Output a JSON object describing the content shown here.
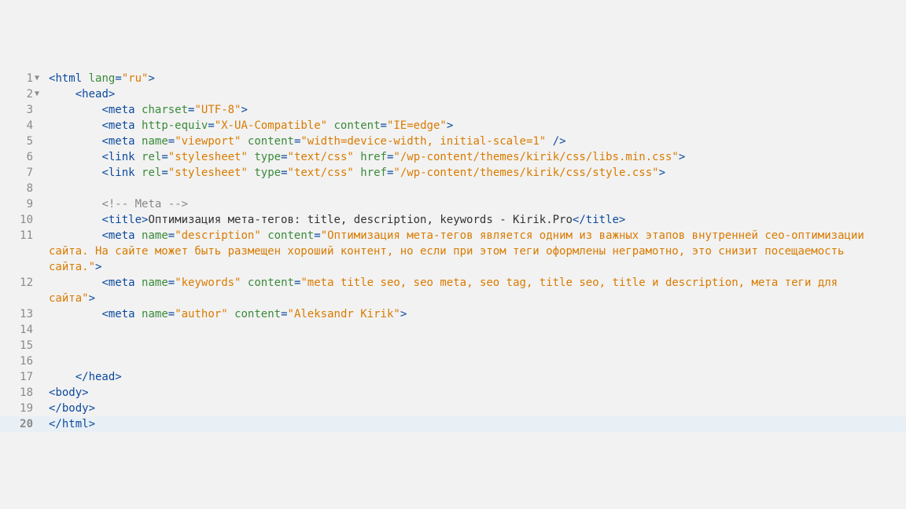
{
  "lines": [
    {
      "num": "1",
      "fold": "▼",
      "indent": 0,
      "tokens": [
        {
          "t": "punct",
          "v": "<"
        },
        {
          "t": "tag",
          "v": "html"
        },
        {
          "t": "text-content",
          "v": " "
        },
        {
          "t": "attr-name",
          "v": "lang"
        },
        {
          "t": "punct",
          "v": "="
        },
        {
          "t": "attr-val",
          "v": "\"ru\""
        },
        {
          "t": "punct",
          "v": ">"
        }
      ]
    },
    {
      "num": "2",
      "fold": "▼",
      "indent": 1,
      "tokens": [
        {
          "t": "punct",
          "v": "<"
        },
        {
          "t": "tag",
          "v": "head"
        },
        {
          "t": "punct",
          "v": ">"
        }
      ]
    },
    {
      "num": "3",
      "fold": "",
      "indent": 2,
      "tokens": [
        {
          "t": "punct",
          "v": "<"
        },
        {
          "t": "tag",
          "v": "meta"
        },
        {
          "t": "text-content",
          "v": " "
        },
        {
          "t": "attr-name",
          "v": "charset"
        },
        {
          "t": "punct",
          "v": "="
        },
        {
          "t": "attr-val",
          "v": "\"UTF-8\""
        },
        {
          "t": "punct",
          "v": ">"
        }
      ]
    },
    {
      "num": "4",
      "fold": "",
      "indent": 2,
      "tokens": [
        {
          "t": "punct",
          "v": "<"
        },
        {
          "t": "tag",
          "v": "meta"
        },
        {
          "t": "text-content",
          "v": " "
        },
        {
          "t": "attr-name",
          "v": "http-equiv"
        },
        {
          "t": "punct",
          "v": "="
        },
        {
          "t": "attr-val",
          "v": "\"X-UA-Compatible\""
        },
        {
          "t": "text-content",
          "v": " "
        },
        {
          "t": "attr-name",
          "v": "content"
        },
        {
          "t": "punct",
          "v": "="
        },
        {
          "t": "attr-val",
          "v": "\"IE=edge\""
        },
        {
          "t": "punct",
          "v": ">"
        }
      ]
    },
    {
      "num": "5",
      "fold": "",
      "indent": 2,
      "tokens": [
        {
          "t": "punct",
          "v": "<"
        },
        {
          "t": "tag",
          "v": "meta"
        },
        {
          "t": "text-content",
          "v": " "
        },
        {
          "t": "attr-name",
          "v": "name"
        },
        {
          "t": "punct",
          "v": "="
        },
        {
          "t": "attr-val",
          "v": "\"viewport\""
        },
        {
          "t": "text-content",
          "v": " "
        },
        {
          "t": "attr-name",
          "v": "content"
        },
        {
          "t": "punct",
          "v": "="
        },
        {
          "t": "attr-val",
          "v": "\"width=device-width, initial-scale=1\""
        },
        {
          "t": "text-content",
          "v": " "
        },
        {
          "t": "punct",
          "v": "/>"
        }
      ]
    },
    {
      "num": "6",
      "fold": "",
      "indent": 2,
      "tokens": [
        {
          "t": "punct",
          "v": "<"
        },
        {
          "t": "tag",
          "v": "link"
        },
        {
          "t": "text-content",
          "v": " "
        },
        {
          "t": "attr-name",
          "v": "rel"
        },
        {
          "t": "punct",
          "v": "="
        },
        {
          "t": "attr-val",
          "v": "\"stylesheet\""
        },
        {
          "t": "text-content",
          "v": " "
        },
        {
          "t": "attr-name",
          "v": "type"
        },
        {
          "t": "punct",
          "v": "="
        },
        {
          "t": "attr-val",
          "v": "\"text/css\""
        },
        {
          "t": "text-content",
          "v": " "
        },
        {
          "t": "attr-name",
          "v": "href"
        },
        {
          "t": "punct",
          "v": "="
        },
        {
          "t": "attr-val",
          "v": "\"/wp-content/themes/kirik/css/libs.min.css\""
        },
        {
          "t": "punct",
          "v": ">"
        }
      ]
    },
    {
      "num": "7",
      "fold": "",
      "indent": 2,
      "tokens": [
        {
          "t": "punct",
          "v": "<"
        },
        {
          "t": "tag",
          "v": "link"
        },
        {
          "t": "text-content",
          "v": " "
        },
        {
          "t": "attr-name",
          "v": "rel"
        },
        {
          "t": "punct",
          "v": "="
        },
        {
          "t": "attr-val",
          "v": "\"stylesheet\""
        },
        {
          "t": "text-content",
          "v": " "
        },
        {
          "t": "attr-name",
          "v": "type"
        },
        {
          "t": "punct",
          "v": "="
        },
        {
          "t": "attr-val",
          "v": "\"text/css\""
        },
        {
          "t": "text-content",
          "v": " "
        },
        {
          "t": "attr-name",
          "v": "href"
        },
        {
          "t": "punct",
          "v": "="
        },
        {
          "t": "attr-val",
          "v": "\"/wp-content/themes/kirik/css/style.css\""
        },
        {
          "t": "punct",
          "v": ">"
        }
      ]
    },
    {
      "num": "8",
      "fold": "",
      "indent": 0,
      "tokens": []
    },
    {
      "num": "9",
      "fold": "",
      "indent": 2,
      "tokens": [
        {
          "t": "comment",
          "v": "<!-- Meta -->"
        }
      ]
    },
    {
      "num": "10",
      "fold": "",
      "indent": 2,
      "tokens": [
        {
          "t": "punct",
          "v": "<"
        },
        {
          "t": "tag",
          "v": "title"
        },
        {
          "t": "punct",
          "v": ">"
        },
        {
          "t": "text-content",
          "v": "Оптимизация мета-тегов: title, description, keywords - Kirik.Pro"
        },
        {
          "t": "punct",
          "v": "</"
        },
        {
          "t": "tag",
          "v": "title"
        },
        {
          "t": "punct",
          "v": ">"
        }
      ]
    },
    {
      "num": "11",
      "fold": "",
      "indent": 2,
      "tokens": [
        {
          "t": "punct",
          "v": "<"
        },
        {
          "t": "tag",
          "v": "meta"
        },
        {
          "t": "text-content",
          "v": " "
        },
        {
          "t": "attr-name",
          "v": "name"
        },
        {
          "t": "punct",
          "v": "="
        },
        {
          "t": "attr-val",
          "v": "\"description\""
        },
        {
          "t": "text-content",
          "v": " "
        },
        {
          "t": "attr-name",
          "v": "content"
        },
        {
          "t": "punct",
          "v": "="
        },
        {
          "t": "attr-val",
          "v": "\"Оптимизация мета-тегов является одним из важных этапов внутренней сео-оптимизации сайта. На сайте может быть размещен хороший контент, но если при этом теги оформлены неграмотно, это снизит посещаемость сайта.\""
        },
        {
          "t": "punct",
          "v": ">"
        }
      ]
    },
    {
      "num": "12",
      "fold": "",
      "indent": 2,
      "tokens": [
        {
          "t": "punct",
          "v": "<"
        },
        {
          "t": "tag",
          "v": "meta"
        },
        {
          "t": "text-content",
          "v": " "
        },
        {
          "t": "attr-name",
          "v": "name"
        },
        {
          "t": "punct",
          "v": "="
        },
        {
          "t": "attr-val",
          "v": "\"keywords\""
        },
        {
          "t": "text-content",
          "v": " "
        },
        {
          "t": "attr-name",
          "v": "content"
        },
        {
          "t": "punct",
          "v": "="
        },
        {
          "t": "attr-val",
          "v": "\"meta title seo, seo meta, seo tag, title seo, title и description, мета теги для сайта\""
        },
        {
          "t": "punct",
          "v": ">"
        }
      ]
    },
    {
      "num": "13",
      "fold": "",
      "indent": 2,
      "tokens": [
        {
          "t": "punct",
          "v": "<"
        },
        {
          "t": "tag",
          "v": "meta"
        },
        {
          "t": "text-content",
          "v": " "
        },
        {
          "t": "attr-name",
          "v": "name"
        },
        {
          "t": "punct",
          "v": "="
        },
        {
          "t": "attr-val",
          "v": "\"author\""
        },
        {
          "t": "text-content",
          "v": " "
        },
        {
          "t": "attr-name",
          "v": "content"
        },
        {
          "t": "punct",
          "v": "="
        },
        {
          "t": "attr-val",
          "v": "\"Aleksandr Kirik\""
        },
        {
          "t": "punct",
          "v": ">"
        }
      ]
    },
    {
      "num": "14",
      "fold": "",
      "indent": 0,
      "tokens": []
    },
    {
      "num": "15",
      "fold": "",
      "indent": 0,
      "tokens": []
    },
    {
      "num": "16",
      "fold": "",
      "indent": 0,
      "tokens": []
    },
    {
      "num": "17",
      "fold": "",
      "indent": 1,
      "tokens": [
        {
          "t": "punct",
          "v": "</"
        },
        {
          "t": "tag",
          "v": "head"
        },
        {
          "t": "punct",
          "v": ">"
        }
      ]
    },
    {
      "num": "18",
      "fold": "",
      "indent": 0,
      "tokens": [
        {
          "t": "punct",
          "v": "<"
        },
        {
          "t": "tag",
          "v": "body"
        },
        {
          "t": "punct",
          "v": ">"
        }
      ]
    },
    {
      "num": "19",
      "fold": "",
      "indent": 0,
      "tokens": [
        {
          "t": "punct",
          "v": "</"
        },
        {
          "t": "tag",
          "v": "body"
        },
        {
          "t": "punct",
          "v": ">"
        }
      ]
    },
    {
      "num": "20",
      "fold": "",
      "indent": 0,
      "highlighted": true,
      "tokens": [
        {
          "t": "punct",
          "v": "</"
        },
        {
          "t": "tag",
          "v": "html"
        },
        {
          "t": "punct",
          "v": ">"
        }
      ]
    }
  ],
  "indentUnit": "    "
}
